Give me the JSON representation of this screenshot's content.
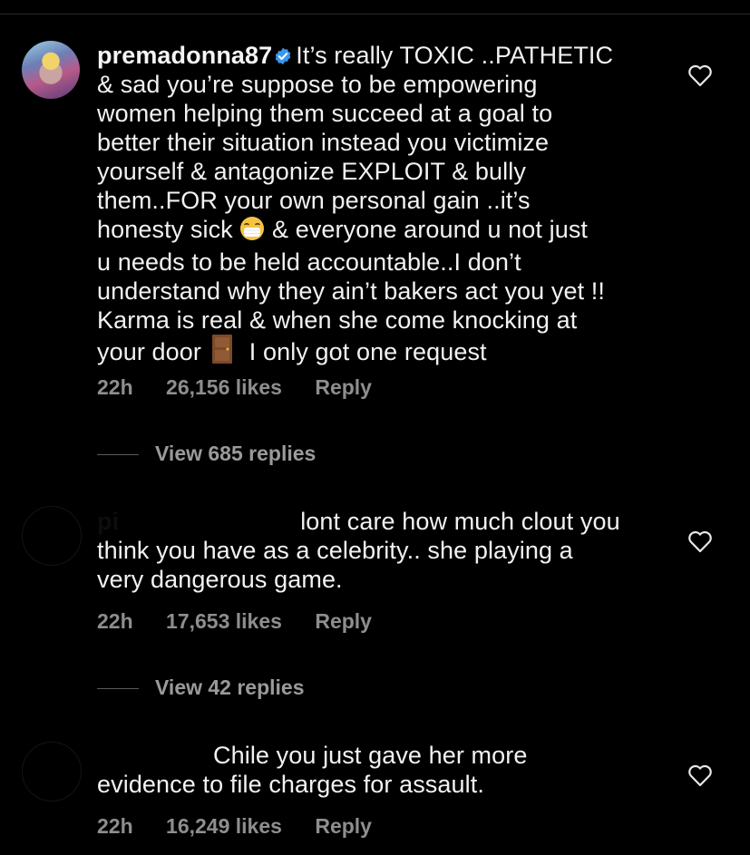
{
  "comments": [
    {
      "username": "premadonna87",
      "verified": true,
      "lines": [
        "It’s really TOXIC ..PATHETIC",
        "& sad you’re suppose to be empowering",
        "women helping them succeed at a goal to",
        "better their situation instead you victimize",
        "yourself & antagonize EXPLOIT & bully",
        "them..FOR your own personal gain ..it’s",
        "honesty sick",
        "& everyone around u not just",
        "u needs to be held accountable..I don’t",
        "understand why they ain’t bakers act you yet !!",
        "Karma is real & when she come knocking at",
        "your door",
        "I only got one request"
      ],
      "emoji_mask": "😷",
      "emoji_door": "🚪",
      "time": "22h",
      "likes": "26,156 likes",
      "reply_label": "Reply",
      "view_replies": "View 685 replies"
    },
    {
      "username": "pi",
      "lines": [
        "lont care how much clout you",
        "think you have as a celebrity.. she playing a",
        "very dangerous game."
      ],
      "time": "22h",
      "likes": "17,653 likes",
      "reply_label": "Reply",
      "view_replies": "View 42 replies"
    },
    {
      "lines": [
        "Chile you just gave her more",
        "evidence to file charges for assault."
      ],
      "time": "22h",
      "likes": "16,249 likes",
      "reply_label": "Reply"
    }
  ],
  "colors": {
    "background": "#000000",
    "text": "#f2f2f2",
    "meta": "#8e8e8e",
    "verified": "#3897f0"
  },
  "icons": [
    "verified-badge-icon",
    "heart-icon"
  ]
}
